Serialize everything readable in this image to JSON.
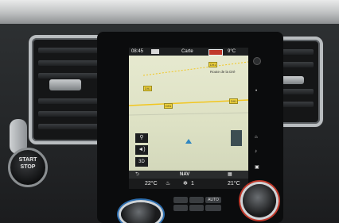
{
  "status_bar": {
    "time": "08:45",
    "screen_title": "Carte",
    "outside_temp": "9°C"
  },
  "map": {
    "road_label": "Route de la Drè",
    "road_tags": [
      "D91",
      "D91",
      "D91",
      "D91"
    ]
  },
  "nav_bar": {
    "nav_label": "NAV"
  },
  "climate": {
    "driver_temp": "22°C",
    "passenger_temp": "21°C",
    "fan_level": "1"
  },
  "side_buttons": {
    "zoom_icon": "magnifier-icon",
    "volume_icon": "speaker-icon",
    "view_3d": "3D"
  },
  "controls": {
    "start_line1": "START",
    "start_line2": "STOP",
    "auto_label": "AUTO"
  }
}
